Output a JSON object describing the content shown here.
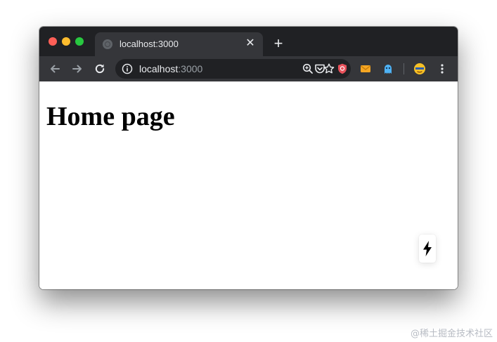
{
  "tab": {
    "title": "localhost:3000",
    "close_icon": "close-icon",
    "new_tab_icon": "plus-icon"
  },
  "toolbar": {
    "back_icon": "back-arrow-icon",
    "forward_icon": "forward-arrow-icon",
    "reload_icon": "reload-icon",
    "omnibox": {
      "host": "localhost",
      "port": ":3000",
      "info_icon": "info-icon",
      "zoom_icon": "zoom-icon",
      "bookmark_icon": "star-icon"
    },
    "extensions": [
      "pocket-icon",
      "shield-extension-icon",
      "mail-extension-icon",
      "ghost-extension-icon",
      "profile-avatar-icon",
      "menu-kebab-icon"
    ]
  },
  "page": {
    "heading": "Home page",
    "fab_icon": "lightning-icon"
  },
  "watermark": "@稀土掘金技术社区",
  "colors": {
    "titlebar": "#202124",
    "toolbar": "#35363a",
    "omnibox": "#202124",
    "page_background": "#ffffff"
  }
}
